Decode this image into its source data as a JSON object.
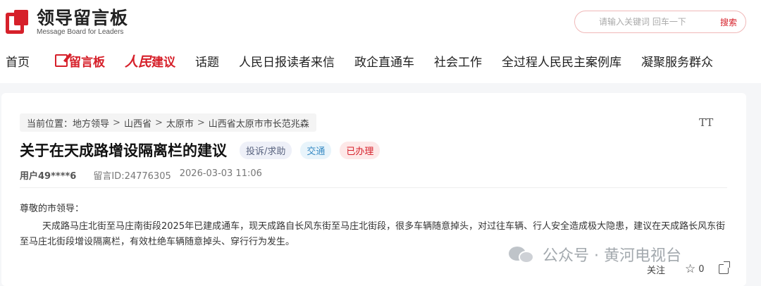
{
  "header": {
    "logo_cn": "领导留言板",
    "logo_en": "Message Board for Leaders",
    "search_placeholder": "请输入关键词 回车一下",
    "search_button": "搜索"
  },
  "nav": {
    "home": "首页",
    "liuyan": "留言板",
    "rmjy_1": "人民",
    "rmjy_2": "建议",
    "topics": "话题",
    "readers": "人民日报读者来信",
    "zhengqi": "政企直通车",
    "social": "社会工作",
    "cases": "全过程人民民主案例库",
    "service": "凝聚服务群众"
  },
  "breadcrumb": {
    "prefix": "当前位置：",
    "items": [
      "地方领导",
      "山西省",
      "太原市",
      "山西省太原市市长范兆森"
    ],
    "separator": ">"
  },
  "font_toggle": "TT",
  "post": {
    "title": "关于在天成路增设隔离栏的建议",
    "tags": {
      "type": "投诉/求助",
      "domain": "交通",
      "status": "已办理"
    },
    "user": "用户49****6",
    "message_id": "留言ID:24776305",
    "datetime": "2026-03-03 11:06",
    "greeting": "尊敬的市领导：",
    "body": "天成路马庄北街至马庄南街段2025年已建成通车，现天成路自长风东街至马庄北街段，很多车辆随意掉头，对过往车辆、行人安全造成极大隐患，建议在天成路长风东街至马庄北街段增设隔离栏，有效杜绝车辆随意掉头、穿行行为发生。"
  },
  "watermark": {
    "text": "公众号 · 黄河电视台"
  },
  "actions": {
    "follow": "关注",
    "star_count": "0"
  },
  "colors": {
    "brand_red": "#d6202a"
  }
}
